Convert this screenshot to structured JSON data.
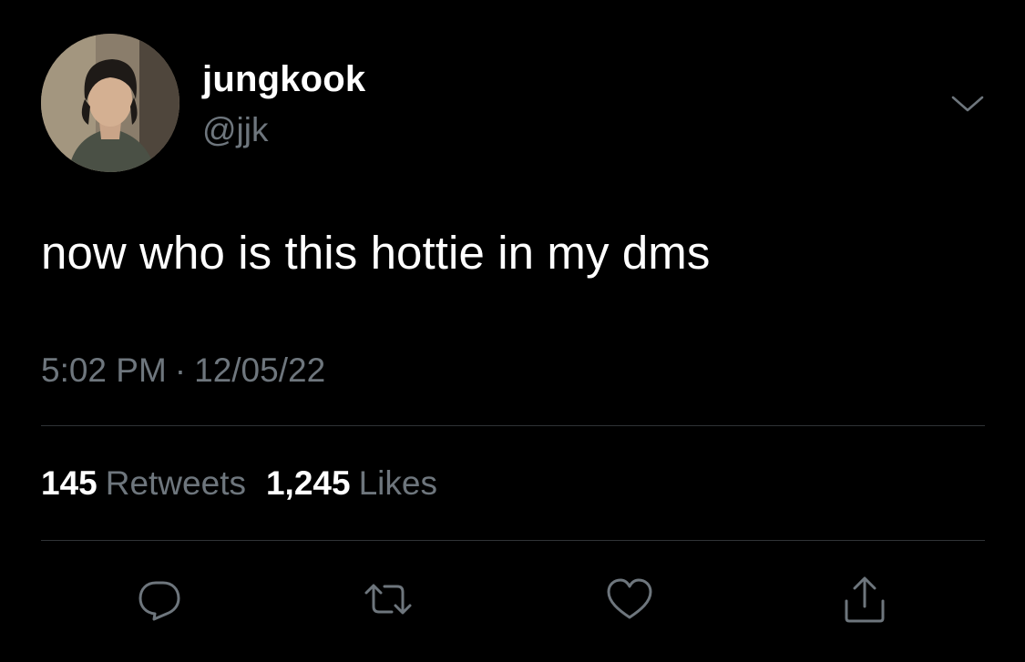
{
  "tweet": {
    "display_name": "jungkook",
    "handle": "@jjk",
    "text": "now who is this hottie in my dms",
    "time": "5:02 PM",
    "separator": "·",
    "date": "12/05/22",
    "stats": {
      "retweets_count": "145",
      "retweets_label": "Retweets",
      "likes_count": "1,245",
      "likes_label": "Likes"
    }
  },
  "icons": {
    "more": "chevron-down-icon",
    "reply": "reply-icon",
    "retweet": "retweet-icon",
    "like": "heart-icon",
    "share": "share-icon"
  },
  "colors": {
    "background": "#000000",
    "primary_text": "#ffffff",
    "secondary_text": "#6e767d",
    "divider": "#2f3336",
    "icon": "#6e767d"
  }
}
